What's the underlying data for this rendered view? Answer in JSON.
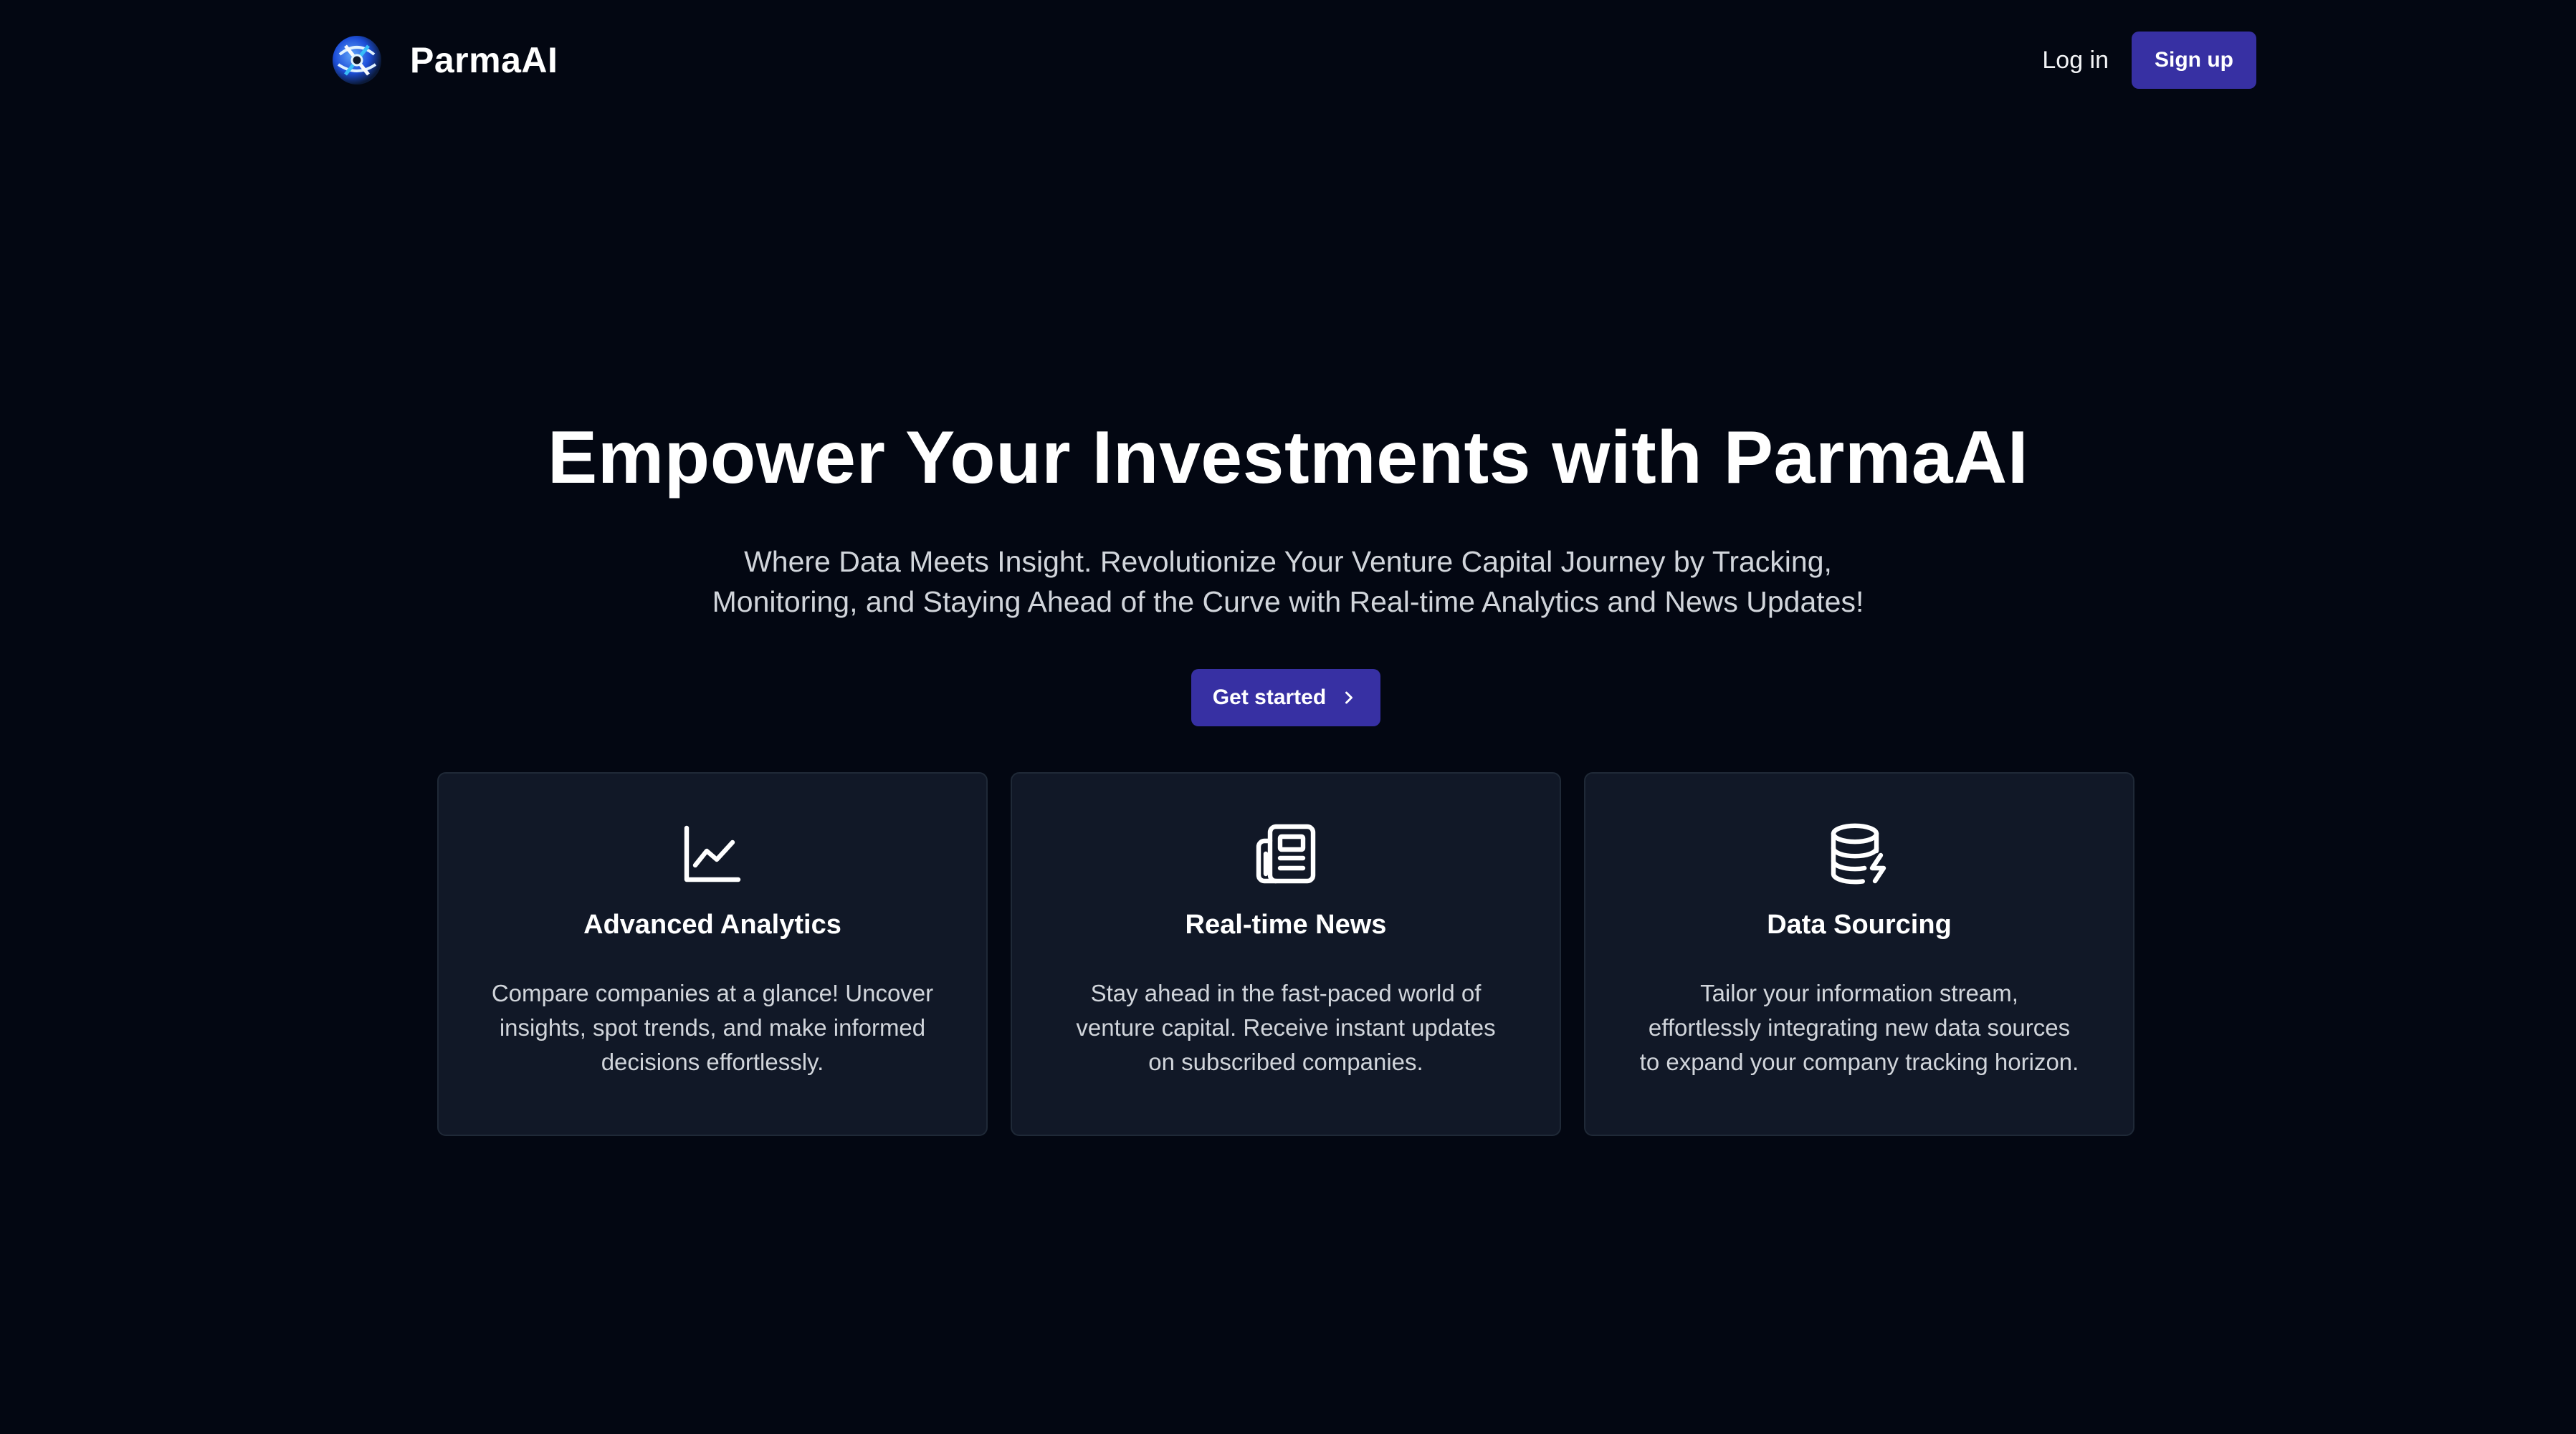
{
  "header": {
    "brand_name": "ParmaAI",
    "login_label": "Log in",
    "signup_label": "Sign up"
  },
  "hero": {
    "title": "Empower Your Investments with ParmaAI",
    "subtitle_line1": "Where Data Meets Insight. Revolutionize Your Venture Capital Journey by Tracking,",
    "subtitle_line2": "Monitoring, and Staying Ahead of the Curve with Real-time Analytics and News Updates!",
    "cta_label": "Get started",
    "cta_icon": "chevron-right-icon"
  },
  "features": [
    {
      "icon": "chart-line-icon",
      "title": "Advanced Analytics",
      "desc_line1": "Compare companies at a glance! Uncover",
      "desc_line2": "insights, spot trends, and make informed",
      "desc_line3": "decisions effortlessly."
    },
    {
      "icon": "newspaper-icon",
      "title": "Real-time News",
      "desc_line1": "Stay ahead in the fast-paced world of",
      "desc_line2": "venture capital. Receive instant updates",
      "desc_line3": "on subscribed companies."
    },
    {
      "icon": "database-bolt-icon",
      "title": "Data Sourcing",
      "desc_line1": "Tailor your information stream,",
      "desc_line2": "effortlessly integrating new data sources",
      "desc_line3": "to expand your company tracking horizon."
    }
  ],
  "colors": {
    "background": "#030712",
    "card_background": "#111827",
    "card_border": "#1f2937",
    "accent": "#3730a3",
    "text_primary": "#ffffff",
    "text_secondary": "#d1d5db"
  }
}
